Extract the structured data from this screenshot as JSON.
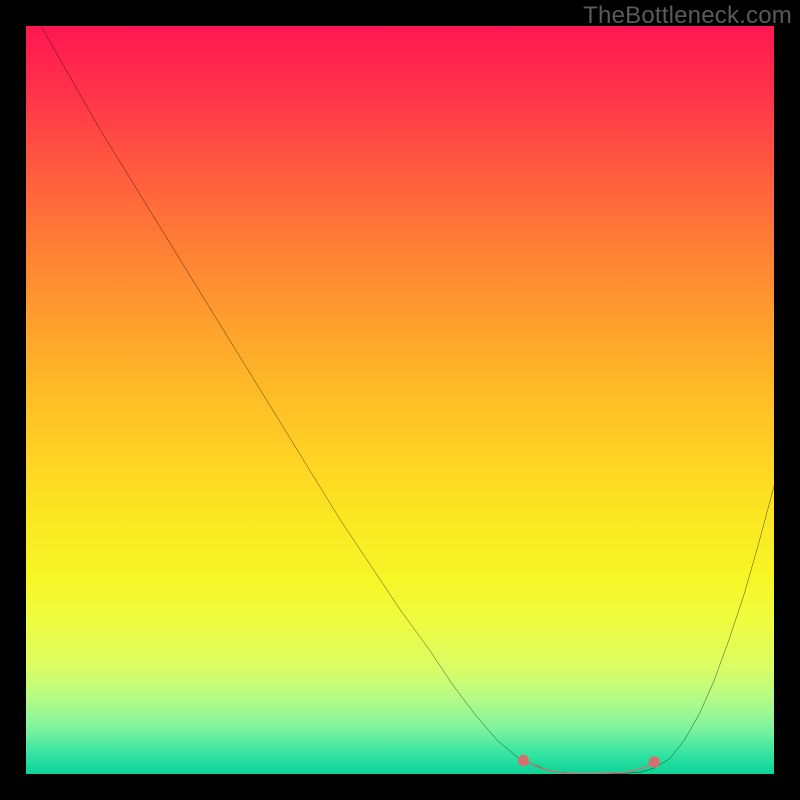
{
  "watermark": "TheBottleneck.com",
  "chart_data": {
    "type": "line",
    "title": "",
    "xlabel": "",
    "ylabel": "",
    "xlim": [
      0,
      100
    ],
    "ylim": [
      0,
      100
    ],
    "series": [
      {
        "name": "bottleneck-curve",
        "x": [
          2,
          6,
          10,
          14,
          18,
          22,
          26,
          30,
          34,
          38,
          42,
          46,
          50,
          54,
          57,
          60,
          63,
          66,
          70,
          74,
          78,
          82,
          84,
          86,
          88,
          90,
          92,
          94,
          96,
          98,
          100
        ],
        "y": [
          100,
          93,
          86,
          79.5,
          73,
          66.5,
          60,
          53.5,
          47,
          40.5,
          34,
          28,
          22,
          16.5,
          12,
          8,
          4.5,
          2,
          0.4,
          0,
          0,
          0.2,
          0.8,
          2,
          4.5,
          8,
          12.5,
          18,
          24,
          31,
          38.5
        ]
      }
    ],
    "highlight_segment": {
      "name": "valley-highlight",
      "color": "#d86f6f",
      "points_x": [
        66.5,
        68.5,
        70,
        72,
        74,
        76,
        78,
        80,
        81.5,
        83,
        84
      ],
      "points_y": [
        1.8,
        0.9,
        0.4,
        0.15,
        0.05,
        0.05,
        0.1,
        0.2,
        0.5,
        1.0,
        1.6
      ],
      "dot_x": [
        66.5,
        84
      ],
      "dot_y": [
        1.8,
        1.6
      ]
    },
    "gradient_stops": [
      {
        "pct": 0,
        "color": "#ff1751"
      },
      {
        "pct": 50,
        "color": "#ffd323"
      },
      {
        "pct": 80,
        "color": "#eefc42"
      },
      {
        "pct": 100,
        "color": "#10d398"
      }
    ]
  }
}
